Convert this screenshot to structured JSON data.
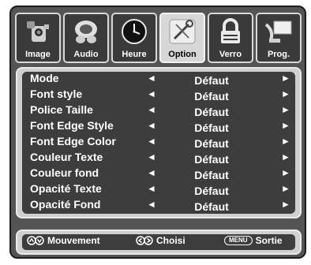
{
  "tabs": [
    {
      "label": "Image",
      "icon": "camcorder-icon",
      "active": false
    },
    {
      "label": "Audio",
      "icon": "speaker-icon",
      "active": false
    },
    {
      "label": "Heure",
      "icon": "clock-icon",
      "active": false
    },
    {
      "label": "Option",
      "icon": "tools-icon",
      "active": true
    },
    {
      "label": "Verro",
      "icon": "padlock-icon",
      "active": false
    },
    {
      "label": "Prog.",
      "icon": "satellite-dish-icon",
      "active": false
    }
  ],
  "menu": {
    "left_arrow": "◄",
    "right_arrow": "►",
    "items": [
      {
        "label": "Mode",
        "value": "Défaut"
      },
      {
        "label": "Font style",
        "value": "Défaut"
      },
      {
        "label": "Police Taille",
        "value": "Défaut"
      },
      {
        "label": "Font Edge Style",
        "value": "Défaut"
      },
      {
        "label": "Font Edge Color",
        "value": "Défaut"
      },
      {
        "label": "Couleur Texte",
        "value": "Défaut"
      },
      {
        "label": "Couleur fond",
        "value": "Défaut"
      },
      {
        "label": "Opacité Texte",
        "value": "Défaut"
      },
      {
        "label": "Opacité Fond",
        "value": "Défaut"
      }
    ]
  },
  "footer": {
    "move_label": "Mouvement",
    "select_label": "Choisi",
    "menu_key": "MENU",
    "exit_label": "Sortie"
  },
  "colors": {
    "frame": "#545454",
    "panel_border": "#cfcfcf",
    "panel_bg": "#3d3d3d",
    "active_tab": "#d7d7d7",
    "text": "#ffffff"
  }
}
